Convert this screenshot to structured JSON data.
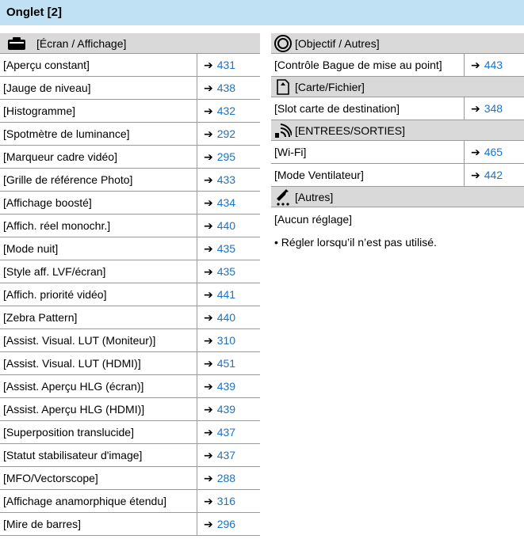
{
  "title": "Onglet [2]",
  "arrow_glyph": "➔",
  "link_color": "#1a73c8",
  "header_color": "#bfe1f3",
  "left": {
    "header": {
      "icon": "monitor-icon",
      "label": "[Écran / Affichage]"
    },
    "rows": [
      {
        "label": "[Aperçu constant]",
        "page": "431"
      },
      {
        "label": "[Jauge de niveau]",
        "page": "438"
      },
      {
        "label": "[Histogramme]",
        "page": "432"
      },
      {
        "label": "[Spotmètre de luminance]",
        "page": "292"
      },
      {
        "label": "[Marqueur cadre vidéo]",
        "page": "295"
      },
      {
        "label": "[Grille de référence Photo]",
        "page": "433"
      },
      {
        "label": "[Affichage boosté]",
        "page": "434"
      },
      {
        "label": "[Affich. réel monochr.]",
        "page": "440"
      },
      {
        "label": "[Mode nuit]",
        "page": "435"
      },
      {
        "label": "[Style aff. LVF/écran]",
        "page": "435"
      },
      {
        "label": "[Affich. priorité vidéo]",
        "page": "441"
      },
      {
        "label": "[Zebra Pattern]",
        "page": "440"
      },
      {
        "label": "[Assist. Visual. LUT (Moniteur)]",
        "page": "310"
      },
      {
        "label": "[Assist. Visual. LUT (HDMI)]",
        "page": "451"
      },
      {
        "label": "[Assist. Aperçu HLG (écran)]",
        "page": "439"
      },
      {
        "label": "[Assist. Aperçu HLG (HDMI)]",
        "page": "439"
      },
      {
        "label": "[Superposition translucide]",
        "page": "437"
      },
      {
        "label": "[Statut stabilisateur d'image]",
        "page": "437"
      },
      {
        "label": "[MFO/Vectorscope]",
        "page": "288"
      },
      {
        "label": "[Affichage anamorphique étendu]",
        "page": "316"
      },
      {
        "label": "[Mire de barres]",
        "page": "296"
      }
    ]
  },
  "right": {
    "sections": [
      {
        "icon": "lens-icon",
        "label": "[Objectif / Autres]",
        "rows": [
          {
            "label": "[Contrôle Bague de mise au point]",
            "page": "443"
          }
        ]
      },
      {
        "icon": "memory-card-icon",
        "label": "[Carte/Fichier]",
        "rows": [
          {
            "label": "[Slot carte de destination]",
            "page": "348"
          }
        ]
      },
      {
        "icon": "wireless-icon",
        "label": "[ENTREES/SORTIES]",
        "rows": [
          {
            "label": "[Wi-Fi]",
            "page": "465"
          },
          {
            "label": "[Mode Ventilateur]",
            "page": "442"
          }
        ]
      },
      {
        "icon": "wrench-icon",
        "label": "[Autres]",
        "rows": [
          {
            "label": "[Aucun réglage]",
            "page": null
          }
        ]
      }
    ],
    "note": "• Régler lorsqu’il n’est pas utilisé."
  }
}
